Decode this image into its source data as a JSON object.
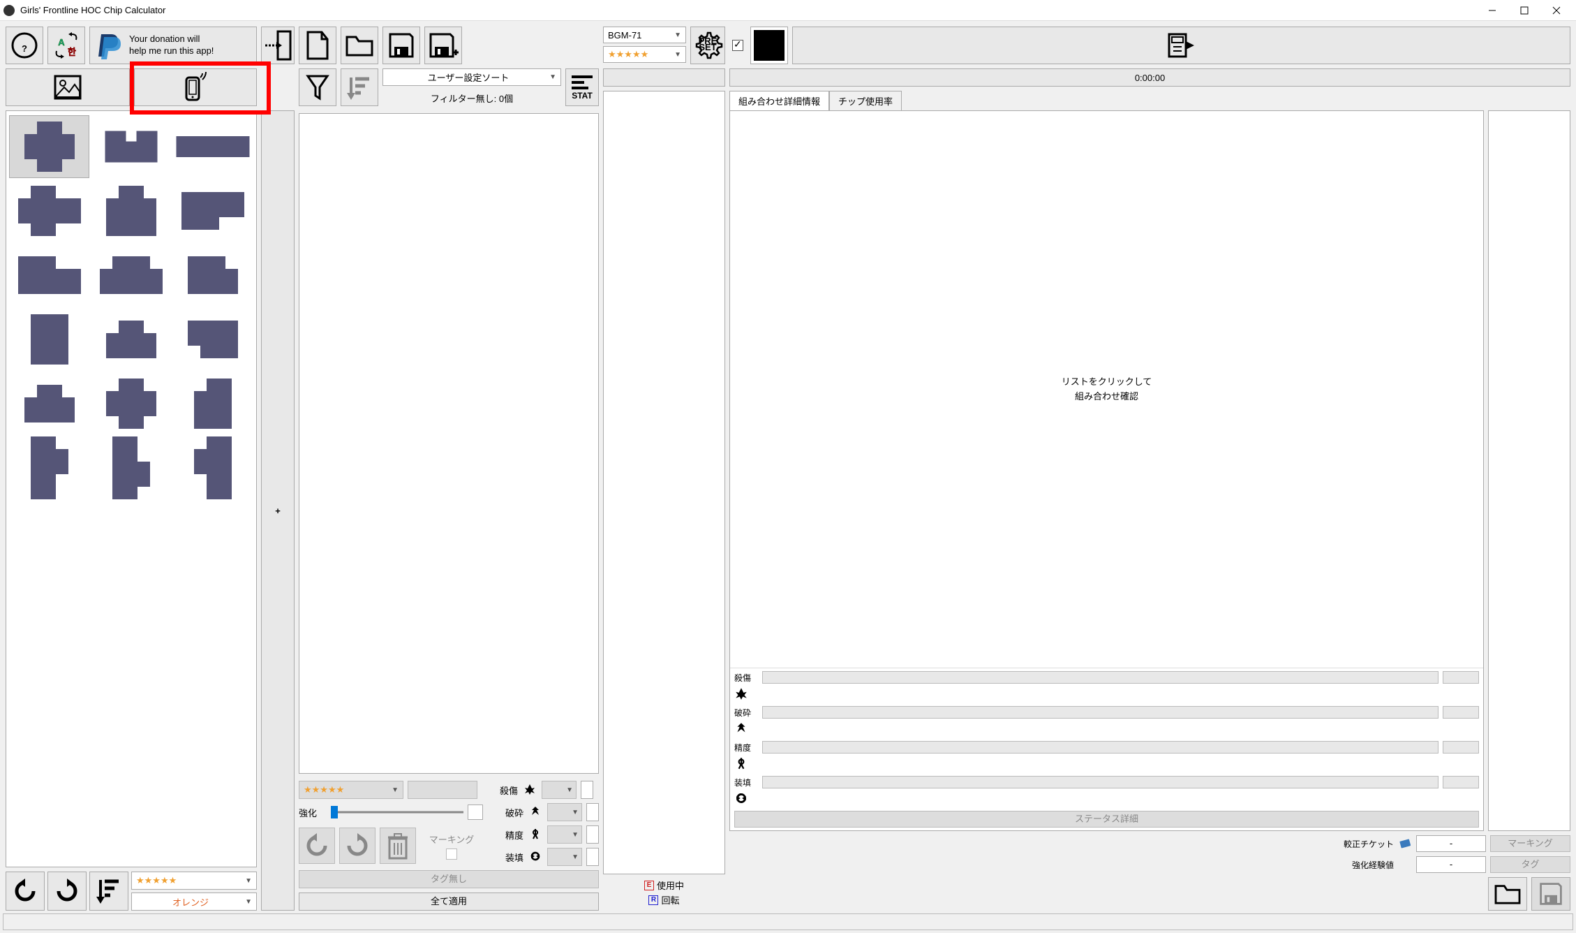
{
  "window": {
    "title": "Girls' Frontline HOC Chip Calculator"
  },
  "donate": {
    "line1": "Your donation will",
    "line2": "help me run this app!"
  },
  "mid": {
    "usersort_label": "ユーザー設定ソート",
    "filter_count": "フィルター無し: 0個",
    "stat_btn": "STAT",
    "enhance_label": "強化",
    "marking_label": "マーキング",
    "tag_none": "タグ無し",
    "apply_all": "全て適用",
    "stars": "★★★★★",
    "stat": {
      "damage": "殺傷",
      "pierce": "破砕",
      "accuracy": "精度",
      "reload": "装填"
    }
  },
  "left": {
    "stars": "★★★★★",
    "color": "オレンジ"
  },
  "hoc": {
    "name": "BGM-71",
    "stars": "★★★★★",
    "timer": "0:00:00",
    "legend_inuse": "使用中",
    "legend_rotate": "回転",
    "tabs": {
      "detail": "組み合わせ詳細情報",
      "usage": "チップ使用率"
    },
    "detail_msg1": "リストをクリックして",
    "detail_msg2": "組み合わせ確認",
    "stat": {
      "damage": "殺傷",
      "pierce": "破砕",
      "accuracy": "精度",
      "reload": "装填"
    },
    "status_detail": "ステータス詳細",
    "ticket_label": "較正チケット",
    "ticket_value": "-",
    "exp_label": "強化経験値",
    "exp_value": "-",
    "marking": "マーキング",
    "tag": "タグ"
  }
}
